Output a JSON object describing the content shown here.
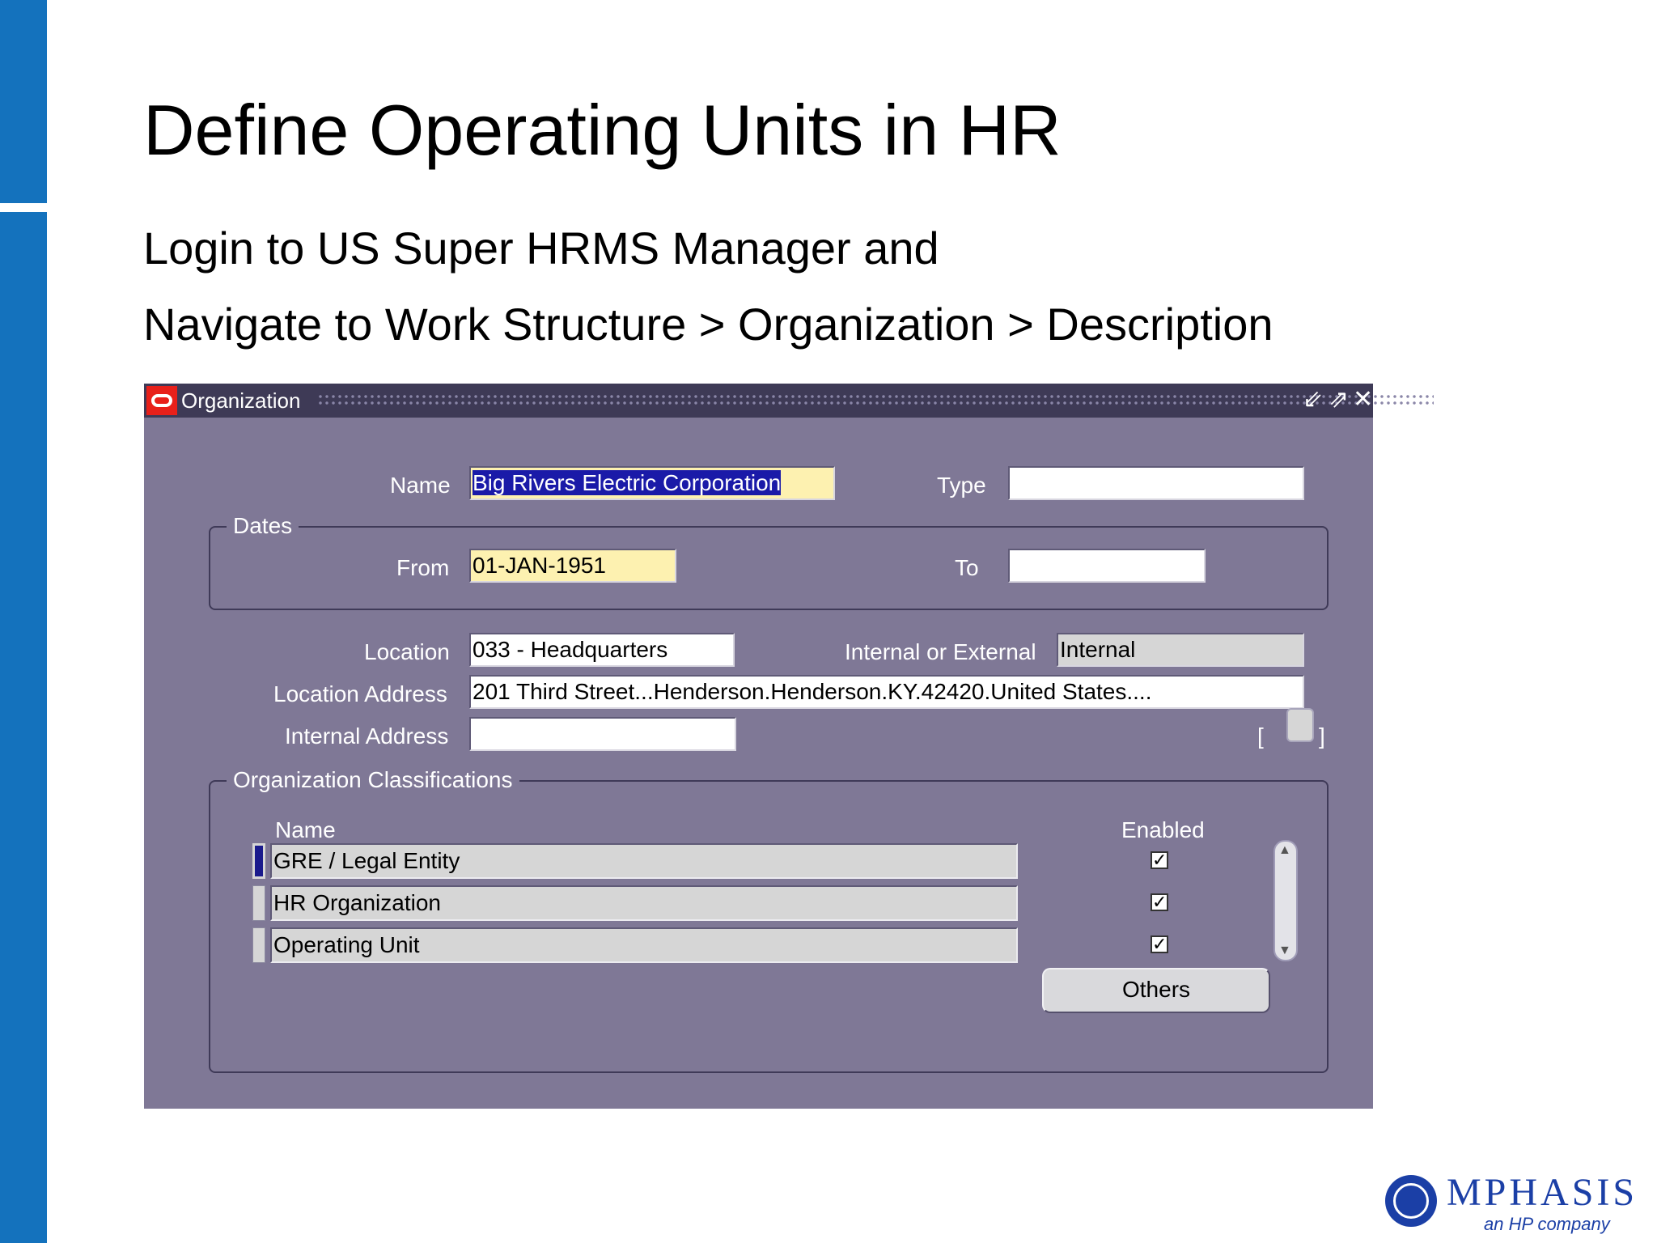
{
  "slide": {
    "title": "Define Operating Units in HR",
    "line1": "Login to US Super HRMS Manager and",
    "line2": "Navigate to Work Structure > Organization > Description"
  },
  "window": {
    "title": "Organization",
    "controls": {
      "minimize": "⇙",
      "maximize": "⇗",
      "close": "✕"
    }
  },
  "form": {
    "name_label": "Name",
    "name_value": "Big Rivers Electric Corporation",
    "type_label": "Type",
    "type_value": "",
    "dates_group": "Dates",
    "from_label": "From",
    "from_value": "01-JAN-1951",
    "to_label": "To",
    "to_value": "",
    "location_label": "Location",
    "location_value": "033 - Headquarters",
    "int_ext_label": "Internal or External",
    "int_ext_value": "Internal",
    "loc_address_label": "Location Address",
    "loc_address_value": "201 Third Street...Henderson.Henderson.KY.42420.United States....",
    "int_address_label": "Internal Address",
    "int_address_value": "",
    "bracket_open": "[",
    "bracket_close": "]"
  },
  "classifications": {
    "group": "Organization Classifications",
    "col_name": "Name",
    "col_enabled": "Enabled",
    "rows": [
      {
        "name": "GRE / Legal Entity",
        "enabled": "✓"
      },
      {
        "name": "HR Organization",
        "enabled": "✓"
      },
      {
        "name": "Operating Unit",
        "enabled": "✓"
      }
    ],
    "others_button": "Others"
  },
  "logo": {
    "name": "MPHASIS",
    "tagline": "an HP company",
    "color": "#1b3fa6"
  },
  "colors": {
    "accent_bar": "#1472bd",
    "form_background": "#7f7896",
    "title_bar": "#3e3a56",
    "required_field": "#fdf1b0"
  }
}
